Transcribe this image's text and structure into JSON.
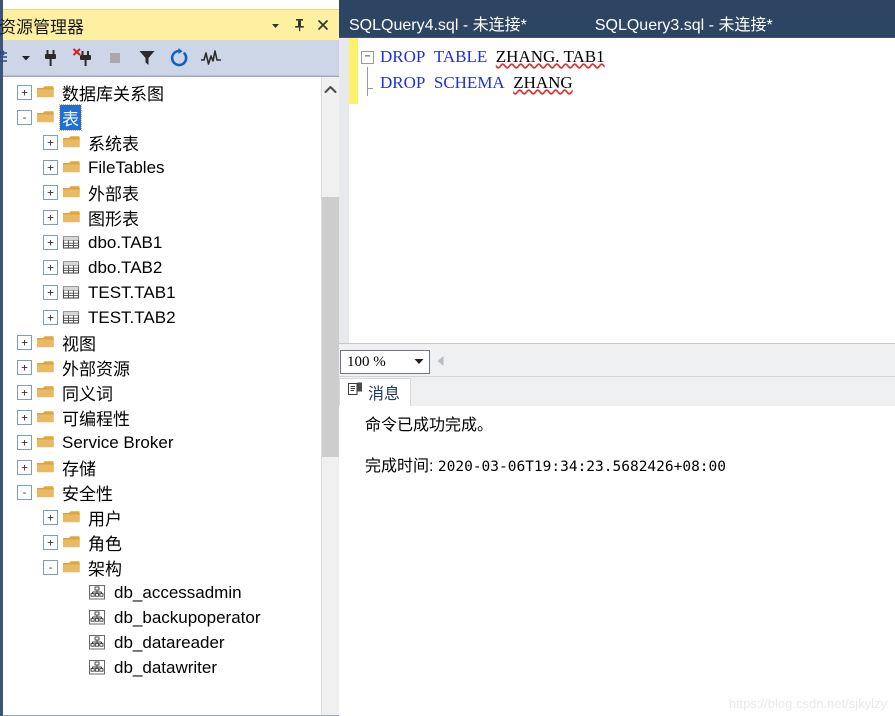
{
  "object_explorer": {
    "title": "资源管理器",
    "titlebar_buttons": [
      {
        "name": "window-menu-dropdown",
        "glyph": "▼"
      },
      {
        "name": "pin-button",
        "glyph": "pin"
      },
      {
        "name": "close-button",
        "glyph": "✕"
      }
    ],
    "toolbar": [
      {
        "name": "connect-dropdown",
        "label": "连接"
      },
      {
        "name": "connect-object-explorer",
        "label": "连接"
      },
      {
        "name": "disconnect-object-explorer",
        "label": "断开连接"
      },
      {
        "name": "stop",
        "label": "停止"
      },
      {
        "name": "filter",
        "label": "筛选器"
      },
      {
        "name": "refresh",
        "label": "刷新"
      },
      {
        "name": "activity-monitor",
        "label": "活动监视器"
      }
    ],
    "tree": [
      {
        "label": "数据库关系图",
        "indent": 0,
        "expander": "+",
        "icon": "folder"
      },
      {
        "label": "表",
        "indent": 0,
        "expander": "-",
        "icon": "folder",
        "selected": true
      },
      {
        "label": "系统表",
        "indent": 1,
        "expander": "+",
        "icon": "folder"
      },
      {
        "label": "FileTables",
        "indent": 1,
        "expander": "+",
        "icon": "folder"
      },
      {
        "label": "外部表",
        "indent": 1,
        "expander": "+",
        "icon": "folder"
      },
      {
        "label": "图形表",
        "indent": 1,
        "expander": "+",
        "icon": "folder"
      },
      {
        "label": "dbo.TAB1",
        "indent": 1,
        "expander": "+",
        "icon": "table"
      },
      {
        "label": "dbo.TAB2",
        "indent": 1,
        "expander": "+",
        "icon": "table"
      },
      {
        "label": "TEST.TAB1",
        "indent": 1,
        "expander": "+",
        "icon": "table"
      },
      {
        "label": "TEST.TAB2",
        "indent": 1,
        "expander": "+",
        "icon": "table"
      },
      {
        "label": "视图",
        "indent": 0,
        "expander": "+",
        "icon": "folder"
      },
      {
        "label": "外部资源",
        "indent": 0,
        "expander": "+",
        "icon": "folder"
      },
      {
        "label": "同义词",
        "indent": 0,
        "expander": "+",
        "icon": "folder"
      },
      {
        "label": "可编程性",
        "indent": 0,
        "expander": "+",
        "icon": "folder"
      },
      {
        "label": "Service Broker",
        "indent": 0,
        "expander": "+",
        "icon": "folder"
      },
      {
        "label": "存储",
        "indent": 0,
        "expander": "+",
        "icon": "folder"
      },
      {
        "label": "安全性",
        "indent": 0,
        "expander": "-",
        "icon": "folder"
      },
      {
        "label": "用户",
        "indent": 1,
        "expander": "+",
        "icon": "folder"
      },
      {
        "label": "角色",
        "indent": 1,
        "expander": "+",
        "icon": "folder"
      },
      {
        "label": "架构",
        "indent": 1,
        "expander": "-",
        "icon": "folder"
      },
      {
        "label": "db_accessadmin",
        "indent": 2,
        "expander": "",
        "icon": "schema"
      },
      {
        "label": "db_backupoperator",
        "indent": 2,
        "expander": "",
        "icon": "schema"
      },
      {
        "label": "db_datareader",
        "indent": 2,
        "expander": "",
        "icon": "schema"
      },
      {
        "label": "db_datawriter",
        "indent": 2,
        "expander": "",
        "icon": "schema"
      }
    ]
  },
  "editor": {
    "tabs": [
      {
        "label": "SQLQuery4.sql - 未连接*",
        "active": true
      },
      {
        "label": "SQLQuery3.sql - 未连接*",
        "active": false
      }
    ],
    "lines": [
      {
        "fold": "-",
        "tokens": [
          {
            "text": "DROP",
            "type": "keyword"
          },
          {
            "text": "  ",
            "type": "plain"
          },
          {
            "text": "TABLE",
            "type": "keyword"
          },
          {
            "text": "  ",
            "type": "plain"
          },
          {
            "text": "ZHANG. TAB1",
            "type": "identifier"
          }
        ]
      },
      {
        "fold": "line-end",
        "tokens": [
          {
            "text": "DROP",
            "type": "keyword"
          },
          {
            "text": "  ",
            "type": "plain"
          },
          {
            "text": "SCHEMA",
            "type": "keyword"
          },
          {
            "text": "  ",
            "type": "plain"
          },
          {
            "text": "ZHANG",
            "type": "identifier"
          }
        ]
      }
    ]
  },
  "results": {
    "zoom_value": "100 %",
    "zoom_arrow": "▼",
    "tab_label": "消息",
    "message_line": "命令已成功完成。",
    "completion_label": "完成时间: ",
    "completion_time": "2020-03-06T19:34:23.5682426+08:00"
  },
  "watermark": "https://blog.csdn.net/sjkylzy",
  "colors": {
    "titlebar_yellow": "#fdf0a0",
    "toolbar_blue": "#ccd6e6",
    "tab_navy": "#2d4563",
    "selection_blue": "#1e6fd9",
    "keyword_blue": "#1d31d6",
    "squiggle_red": "#e03131",
    "change_margin_yellow": "#fdf06a"
  }
}
